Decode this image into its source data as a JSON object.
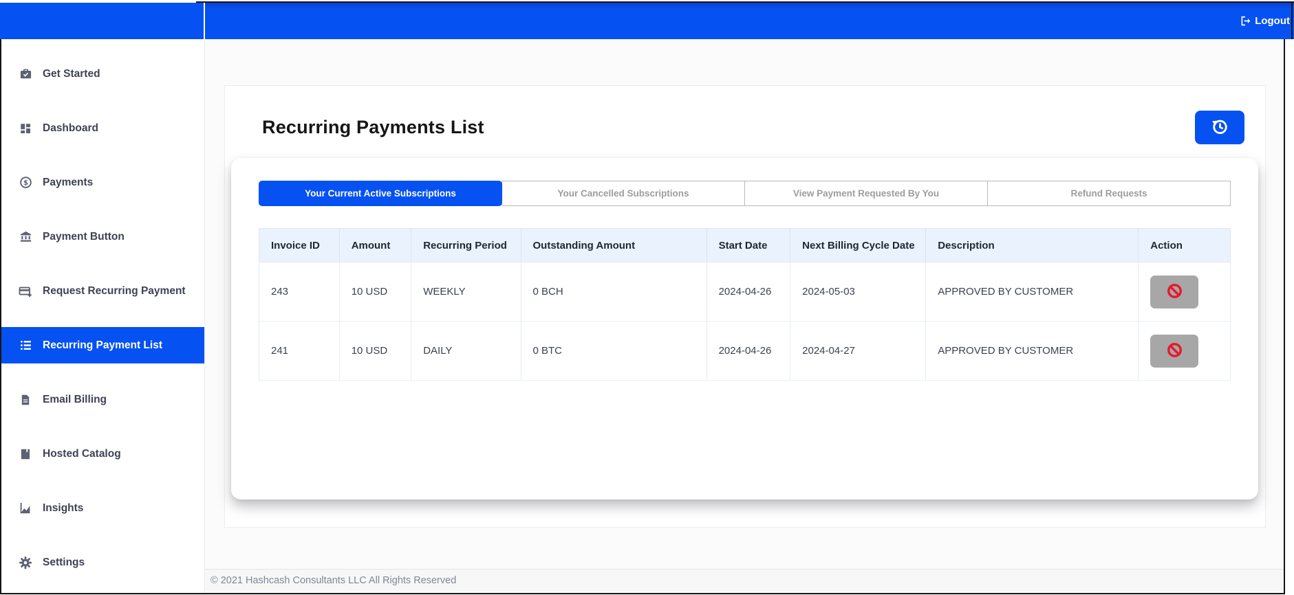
{
  "colors": {
    "primary": "#0551f1",
    "action_red": "#e8192c",
    "table_header_bg": "#eaf2fd",
    "action_button_bg": "#a7a7a7"
  },
  "header": {
    "logout_label": "Logout"
  },
  "sidebar": {
    "items": [
      {
        "label": "Get Started",
        "icon": "briefcase-check",
        "active": false
      },
      {
        "label": "Dashboard",
        "icon": "grid",
        "active": false
      },
      {
        "label": "Payments",
        "icon": "dollar-circle",
        "active": false
      },
      {
        "label": "Payment Button",
        "icon": "bank",
        "active": false
      },
      {
        "label": "Request Recurring Payment",
        "icon": "card-plus",
        "active": false
      },
      {
        "label": "Recurring Payment List",
        "icon": "list",
        "active": true
      },
      {
        "label": "Email Billing",
        "icon": "document",
        "active": false
      },
      {
        "label": "Hosted Catalog",
        "icon": "book",
        "active": false
      },
      {
        "label": "Insights",
        "icon": "chart",
        "active": false
      },
      {
        "label": "Settings",
        "icon": "gear",
        "active": false
      }
    ]
  },
  "main": {
    "title": "Recurring Payments List",
    "tabs": [
      {
        "label": "Your Current Active Subscriptions",
        "active": true
      },
      {
        "label": "Your Cancelled Subscriptions",
        "active": false
      },
      {
        "label": "View Payment Requested By You",
        "active": false
      },
      {
        "label": "Refund Requests",
        "active": false
      }
    ],
    "table": {
      "columns": [
        {
          "label": "Invoice ID",
          "key": "invoice_id"
        },
        {
          "label": "Amount",
          "key": "amount"
        },
        {
          "label": "Recurring Period",
          "key": "recurring_period"
        },
        {
          "label": "Outstanding Amount",
          "key": "outstanding_amount"
        },
        {
          "label": "Start Date",
          "key": "start_date"
        },
        {
          "label": "Next Billing Cycle Date",
          "key": "next_billing_cycle_date"
        },
        {
          "label": "Description",
          "key": "description"
        },
        {
          "label": "Action",
          "key": "_action"
        }
      ],
      "rows": [
        {
          "invoice_id": "243",
          "amount": "10 USD",
          "recurring_period": "WEEKLY",
          "outstanding_amount": "0 BCH",
          "start_date": "2024-04-26",
          "next_billing_cycle_date": "2024-05-03",
          "description": "APPROVED BY CUSTOMER"
        },
        {
          "invoice_id": "241",
          "amount": "10 USD",
          "recurring_period": "DAILY",
          "outstanding_amount": "0 BTC",
          "start_date": "2024-04-26",
          "next_billing_cycle_date": "2024-04-27",
          "description": "APPROVED BY CUSTOMER"
        }
      ]
    }
  },
  "footer": {
    "copyright": "© 2021 Hashcash Consultants LLC All Rights Reserved"
  }
}
